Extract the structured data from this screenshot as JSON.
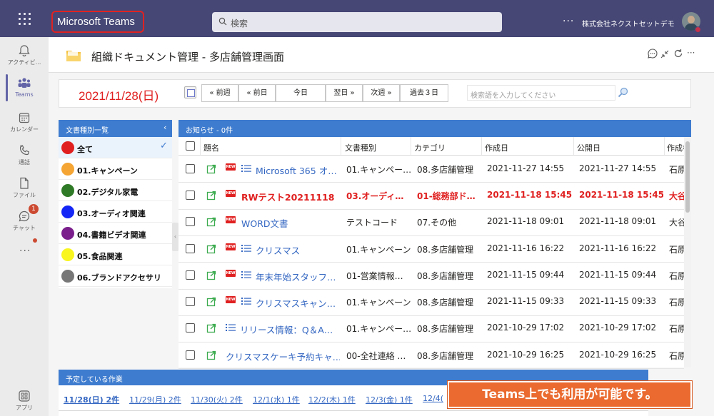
{
  "topbar": {
    "app_title": "Microsoft Teams",
    "search_placeholder": "検索",
    "more": "···",
    "org_name": "株式会社ネクストセットデモ"
  },
  "rail": [
    {
      "label": "アクティビ...",
      "icon": "bell-icon"
    },
    {
      "label": "Teams",
      "icon": "teams-icon"
    },
    {
      "label": "カレンダー",
      "icon": "calendar-icon"
    },
    {
      "label": "通話",
      "icon": "phone-icon"
    },
    {
      "label": "ファイル",
      "icon": "file-icon"
    },
    {
      "label": "チャット",
      "icon": "chat-icon"
    },
    {
      "label": "アプリ",
      "icon": "apps-icon"
    }
  ],
  "rail_badge": "1",
  "rail_more": "···",
  "page": {
    "title": "組織ドキュメント管理 - 多店舗管理画面"
  },
  "date_nav": {
    "current_date": "2021/11/28(日)",
    "buttons": [
      "« 前週",
      "« 前日",
      "今日",
      "翌日 »",
      "次週 »",
      "過去３日"
    ],
    "keyword_placeholder": "検索語を入力してください"
  },
  "categories": {
    "header": "文書種別一覧",
    "collapse": "‹",
    "items": [
      {
        "label": "全て",
        "color": "#e02020",
        "selected": true
      },
      {
        "label": "01.キャンペーン",
        "color": "#f4a534"
      },
      {
        "label": "02.デジタル家電",
        "color": "#2f7a26"
      },
      {
        "label": "03.オーディオ関連",
        "color": "#1426f5"
      },
      {
        "label": "04.書籍ビデオ関連",
        "color": "#7a1f8c"
      },
      {
        "label": "05.食品関連",
        "color": "#f8f51f"
      },
      {
        "label": "06.ブランドアクセサリ",
        "color": "#777777"
      }
    ]
  },
  "notices": {
    "header": "お知らせ - 0件",
    "columns": [
      "題名",
      "文書種別",
      "カテゴリ",
      "作成日",
      "公開日",
      "作成者"
    ],
    "rows": [
      {
        "title": "Microsoft 365 オ…",
        "type": "01.キャンペー…",
        "category": "08.多店舗管理",
        "created": "2021-11-27 14:55",
        "published": "2021-11-27 14:55",
        "author": "石原",
        "is_new": true,
        "has_list": true,
        "highlight": false
      },
      {
        "title": "RWテスト20211118",
        "type": "03.オーディ…",
        "category": "01-総務部ド…",
        "created": "2021-11-18 15:45",
        "published": "2021-11-18 15:45",
        "author": "大谷",
        "is_new": true,
        "has_list": false,
        "highlight": true
      },
      {
        "title": "WORD文書",
        "type": "テストコード",
        "category": "07.その他",
        "created": "2021-11-18 09:01",
        "published": "2021-11-18 09:01",
        "author": "大谷",
        "is_new": true,
        "has_list": false,
        "highlight": false
      },
      {
        "title": "クリスマス",
        "type": "01.キャンペーン",
        "category": "08.多店舗管理",
        "created": "2021-11-16 16:22",
        "published": "2021-11-16 16:22",
        "author": "石原",
        "is_new": true,
        "has_list": true,
        "highlight": false
      },
      {
        "title": "年末年始スタッフ…",
        "type": "01-営業情報…",
        "category": "08.多店舗管理",
        "created": "2021-11-15 09:44",
        "published": "2021-11-15 09:44",
        "author": "石原",
        "is_new": true,
        "has_list": true,
        "highlight": false
      },
      {
        "title": "クリスマスキャン…",
        "type": "01.キャンペーン",
        "category": "08.多店舗管理",
        "created": "2021-11-15 09:33",
        "published": "2021-11-15 09:33",
        "author": "石原",
        "is_new": true,
        "has_list": true,
        "highlight": false
      },
      {
        "title": "リリース情報：Q＆A…",
        "type": "01.キャンペー…",
        "category": "08.多店舗管理",
        "created": "2021-10-29 17:02",
        "published": "2021-10-29 17:02",
        "author": "石原",
        "is_new": false,
        "has_list": true,
        "highlight": false
      },
      {
        "title": "クリスマスケーキ予約キャ…",
        "type": "00-全社連絡 …",
        "category": "08.多店舗管理",
        "created": "2021-10-29 16:25",
        "published": "2021-10-29 16:25",
        "author": "石原",
        "is_new": false,
        "has_list": false,
        "highlight": false
      }
    ]
  },
  "schedule": {
    "header": "予定している作業",
    "tabs": [
      "11/28(日) 2件",
      "11/29(月) 2件",
      "11/30(火) 2件",
      "12/1(水) 1件",
      "12/2(木) 1件",
      "12/3(金) 1件",
      "12/4("
    ]
  },
  "callout": "Teams上でも利用が可能です。",
  "colors": {
    "topbar": "#464775",
    "accent": "#3e7ccf",
    "highlight_red": "#e02020",
    "callout": "#ea6a2f"
  }
}
